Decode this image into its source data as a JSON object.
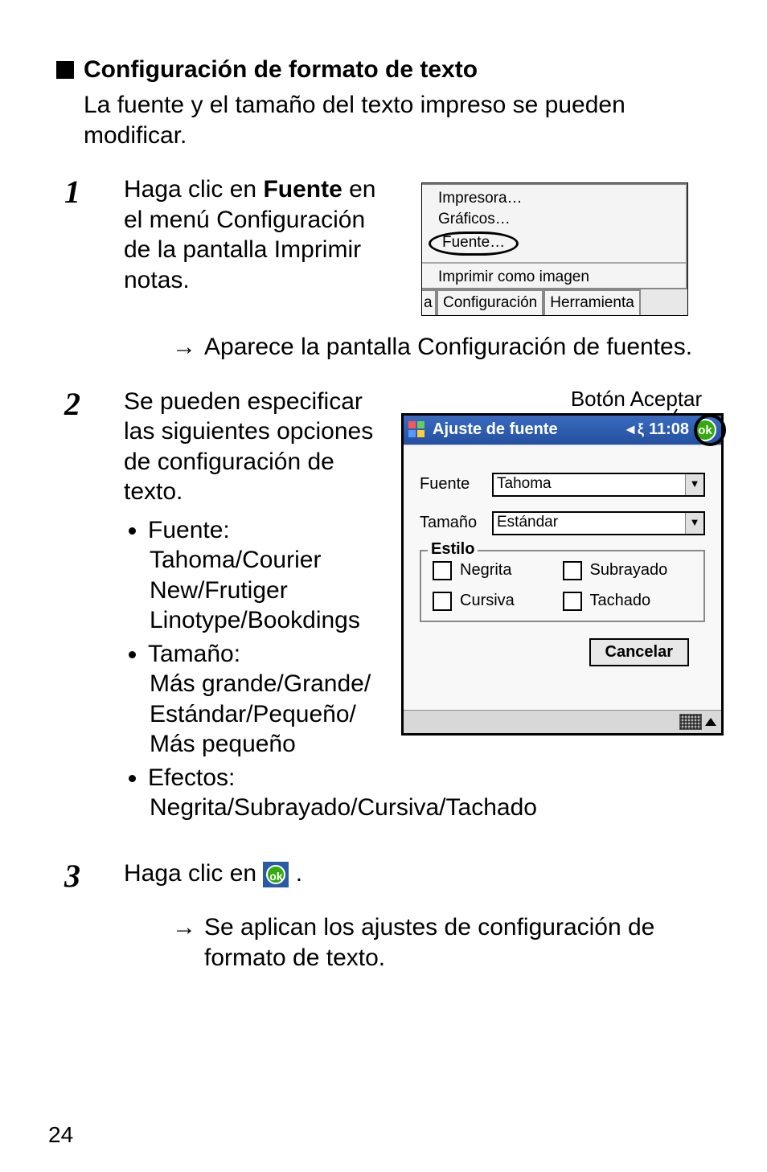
{
  "heading": "Configuración de formato de texto",
  "intro": "La fuente y el tamaño del texto impreso se pueden modificar.",
  "steps": {
    "s1": {
      "num": "1",
      "text_prefix": "Haga clic en ",
      "text_bold": "Fuente",
      "text_suffix": " en el menú Configuración de la pantalla Imprimir notas.",
      "result": "Aparece la pantalla Configuración de fuentes."
    },
    "s2": {
      "num": "2",
      "text": "Se pueden especificar las siguientes opciones de configuración de texto.",
      "bullets": {
        "b1_label": "Fuente:",
        "b1_body": "Tahoma/Courier New/Frutiger Linotype/Bookdings",
        "b2_label": "Tamaño:",
        "b2_body": "Más grande/Grande/ Estándar/Pequeño/ Más pequeño",
        "b3_label": "Efectos:",
        "b3_body": "Negrita/Subrayado/Cursiva/Tachado"
      }
    },
    "s3": {
      "num": "3",
      "text_prefix": "Haga clic en ",
      "text_suffix": " .",
      "result": "Se aplican los ajustes de configuración de formato de texto."
    }
  },
  "menu": {
    "item1": "Impresora…",
    "item2": "Gráficos…",
    "item3": "Fuente…",
    "item4": "Imprimir como imagen",
    "tab0": "a",
    "tab1": "Configuración",
    "tab2": "Herramienta"
  },
  "dialog": {
    "annot": "Botón Aceptar",
    "title": "Ajuste de fuente",
    "time": "11:08",
    "ok": "ok",
    "label_font": "Fuente",
    "value_font": "Tahoma",
    "label_size": "Tamaño",
    "value_size": "Estándar",
    "group_title": "Estilo",
    "check_bold": "Negrita",
    "check_under": "Subrayado",
    "check_italic": "Cursiva",
    "check_strike": "Tachado",
    "btn_cancel": "Cancelar"
  },
  "glyphs": {
    "arrow": "→",
    "vol": "◄ξ",
    "combo_arrow": "▼"
  },
  "page_number": "24"
}
